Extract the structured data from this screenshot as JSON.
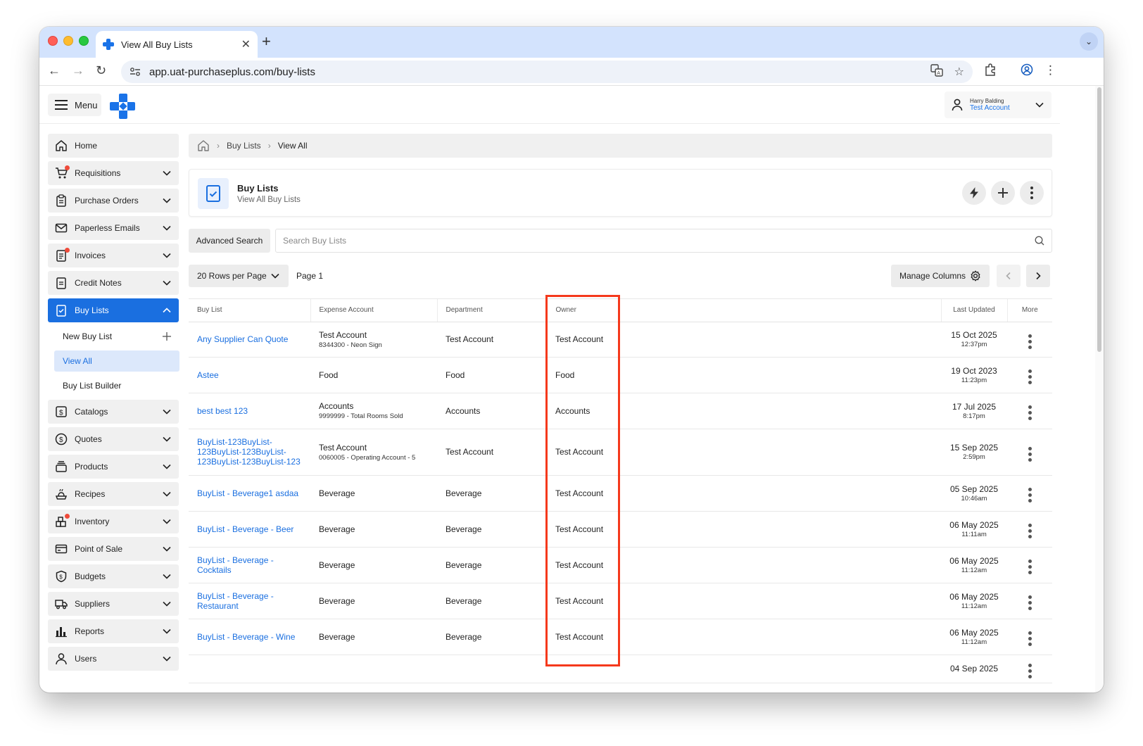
{
  "browser": {
    "tab_title": "View All Buy Lists",
    "url": "app.uat-purchaseplus.com/buy-lists"
  },
  "header": {
    "menu_label": "Menu",
    "user_name": "Harry Balding",
    "user_account": "Test Account"
  },
  "sidebar": {
    "items": [
      {
        "label": "Home",
        "icon": "home-icon"
      },
      {
        "label": "Requisitions",
        "icon": "cart-icon"
      },
      {
        "label": "Purchase Orders",
        "icon": "clipboard-icon"
      },
      {
        "label": "Paperless Emails",
        "icon": "mail-icon"
      },
      {
        "label": "Invoices",
        "icon": "invoice-icon"
      },
      {
        "label": "Credit Notes",
        "icon": "credit-note-icon"
      },
      {
        "label": "Buy Lists",
        "icon": "checklist-icon"
      },
      {
        "label": "Catalogs",
        "icon": "catalog-icon"
      },
      {
        "label": "Quotes",
        "icon": "dollar-circle-icon"
      },
      {
        "label": "Products",
        "icon": "products-icon"
      },
      {
        "label": "Recipes",
        "icon": "recipe-icon"
      },
      {
        "label": "Inventory",
        "icon": "inventory-icon"
      },
      {
        "label": "Point of Sale",
        "icon": "pos-icon"
      },
      {
        "label": "Budgets",
        "icon": "budget-shield-icon"
      },
      {
        "label": "Suppliers",
        "icon": "truck-icon"
      },
      {
        "label": "Reports",
        "icon": "chart-icon"
      },
      {
        "label": "Users",
        "icon": "user-icon"
      }
    ],
    "buy_lists_sub": {
      "new": "New Buy List",
      "view_all": "View All",
      "builder": "Buy List Builder"
    }
  },
  "breadcrumb": {
    "items": [
      "Buy Lists",
      "View All"
    ]
  },
  "page": {
    "title": "Buy Lists",
    "subtitle": "View All Buy Lists"
  },
  "search": {
    "advanced_label": "Advanced Search",
    "placeholder": "Search Buy Lists"
  },
  "controls": {
    "rows_per_page": "20 Rows per Page",
    "page_label": "Page 1",
    "manage_columns": "Manage Columns"
  },
  "table": {
    "columns": [
      "Buy List",
      "Expense Account",
      "Department",
      "Owner",
      "Last Updated",
      "More"
    ],
    "rows": [
      {
        "name": "Any Supplier Can Quote",
        "expense": "Test Account",
        "expense_sub": "8344300 - Neon Sign",
        "department": "Test Account",
        "owner": "Test Account",
        "date": "15 Oct 2025",
        "time": "12:37pm"
      },
      {
        "name": "Astee",
        "expense": "Food",
        "expense_sub": "",
        "department": "Food",
        "owner": "Food",
        "date": "19 Oct 2023",
        "time": "11:23pm"
      },
      {
        "name": "best best 123",
        "expense": "Accounts",
        "expense_sub": "9999999 - Total Rooms Sold",
        "department": "Accounts",
        "owner": "Accounts",
        "date": "17 Jul 2025",
        "time": "8:17pm"
      },
      {
        "name": "BuyList-123BuyList-123BuyList-123BuyList-123BuyList-123BuyList-123",
        "expense": "Test Account",
        "expense_sub": "0060005 - Operating Account - 5",
        "department": "Test Account",
        "owner": "Test Account",
        "date": "15 Sep 2025",
        "time": "2:59pm"
      },
      {
        "name": "BuyList - Beverage1 asdaa",
        "expense": "Beverage",
        "expense_sub": "",
        "department": "Beverage",
        "owner": "Test Account",
        "date": "05 Sep 2025",
        "time": "10:46am"
      },
      {
        "name": "BuyList - Beverage - Beer",
        "expense": "Beverage",
        "expense_sub": "",
        "department": "Beverage",
        "owner": "Test Account",
        "date": "06 May 2025",
        "time": "11:11am"
      },
      {
        "name": "BuyList - Beverage - Cocktails",
        "expense": "Beverage",
        "expense_sub": "",
        "department": "Beverage",
        "owner": "Test Account",
        "date": "06 May 2025",
        "time": "11:12am"
      },
      {
        "name": "BuyList - Beverage - Restaurant",
        "expense": "Beverage",
        "expense_sub": "",
        "department": "Beverage",
        "owner": "Test Account",
        "date": "06 May 2025",
        "time": "11:12am"
      },
      {
        "name": "BuyList - Beverage - Wine",
        "expense": "Beverage",
        "expense_sub": "",
        "department": "Beverage",
        "owner": "Test Account",
        "date": "06 May 2025",
        "time": "11:12am"
      },
      {
        "name": "",
        "expense": "",
        "expense_sub": "",
        "department": "",
        "owner": "",
        "date": "04 Sep 2025",
        "time": ""
      }
    ]
  },
  "colors": {
    "accent": "#1a6fe0",
    "highlight": "#f5391c",
    "badge": "#ef4b3a"
  }
}
